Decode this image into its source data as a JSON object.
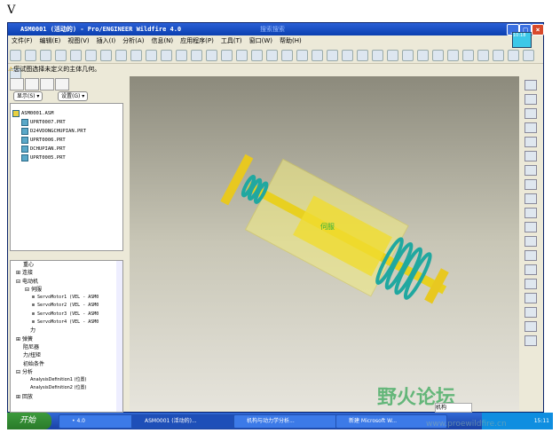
{
  "cursor_letter": "V",
  "window": {
    "title": "ASM0001 (活动的) - Pro/ENGINEER Wildfire 4.0",
    "search_tab": "搜索搜索"
  },
  "menu": [
    "文件(F)",
    "编辑(E)",
    "视图(V)",
    "插入(I)",
    "分析(A)",
    "信息(N)",
    "应用程序(P)",
    "工具(T)",
    "窗口(W)",
    "帮助(H)"
  ],
  "message": "您试图选择未定义的主体几何。",
  "clock_popup": "10:18",
  "left_panel": {
    "show_dropdown": "显示(S)",
    "settings_dropdown": "设置(G)",
    "model_tree": [
      "ASM0001.ASM",
      "UPRT0007.PRT",
      "D24VDONGCHUPIAN.PRT",
      "UPRT0006.PRT",
      "DCHUPIAN.PRT",
      "UPRT0005.PRT"
    ],
    "mech_tree": [
      "重心",
      "连接",
      "电动机",
      "伺服",
      "ServoMotor1 (VEL - ASM0",
      "ServoMotor2 (VEL - ASM0",
      "ServoMotor3 (VEL - ASM0",
      "ServoMotor4 (VEL - ASM0",
      "力",
      "弹簧",
      "阻尼器",
      "力/扭矩",
      "初始条件",
      "分析",
      "AnalysisDefinition1 (位置)",
      "AnalysisDefinition2 (位置)",
      "回放"
    ]
  },
  "viewport": {
    "label": "伺服"
  },
  "taskbar": {
    "start": "开始",
    "tasks": [
      "• 4.0",
      "ASM0001 (活动的)...",
      "机构与动力学分析...",
      "新建 Microsoft W..."
    ],
    "search": "机构",
    "clock": "15:11"
  },
  "watermark": {
    "text": "野火论坛",
    "url": "www.proewildfire.cn"
  }
}
